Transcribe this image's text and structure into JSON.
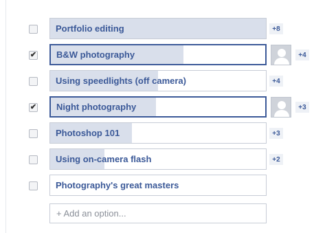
{
  "poll": {
    "options": [
      {
        "label": "Portfolio editing",
        "checked": false,
        "votes": "+8",
        "fill_fraction": 1.0,
        "has_avatar": false
      },
      {
        "label": "B&W photography",
        "checked": true,
        "votes": "+4",
        "fill_fraction": 0.62,
        "has_avatar": true
      },
      {
        "label": "Using speedlights (off camera)",
        "checked": false,
        "votes": "+4",
        "fill_fraction": 0.5,
        "has_avatar": false
      },
      {
        "label": "Night photography",
        "checked": true,
        "votes": "+3",
        "fill_fraction": 0.49,
        "has_avatar": true
      },
      {
        "label": "Photoshop 101",
        "checked": false,
        "votes": "+3",
        "fill_fraction": 0.38,
        "has_avatar": false
      },
      {
        "label": "Using on-camera flash",
        "checked": false,
        "votes": "+2",
        "fill_fraction": 0.25,
        "has_avatar": false
      },
      {
        "label": "Photography's great masters",
        "checked": false,
        "votes": "",
        "fill_fraction": 0,
        "has_avatar": false
      }
    ],
    "add_option": {
      "placeholder": "+ Add an option..."
    },
    "colors": {
      "accent": "#3b5998",
      "fill": "#d9dfeb",
      "border": "#c7ccd6"
    },
    "checkbox_glyph": "✔",
    "icons": {
      "avatar": "user-avatar-icon"
    }
  }
}
